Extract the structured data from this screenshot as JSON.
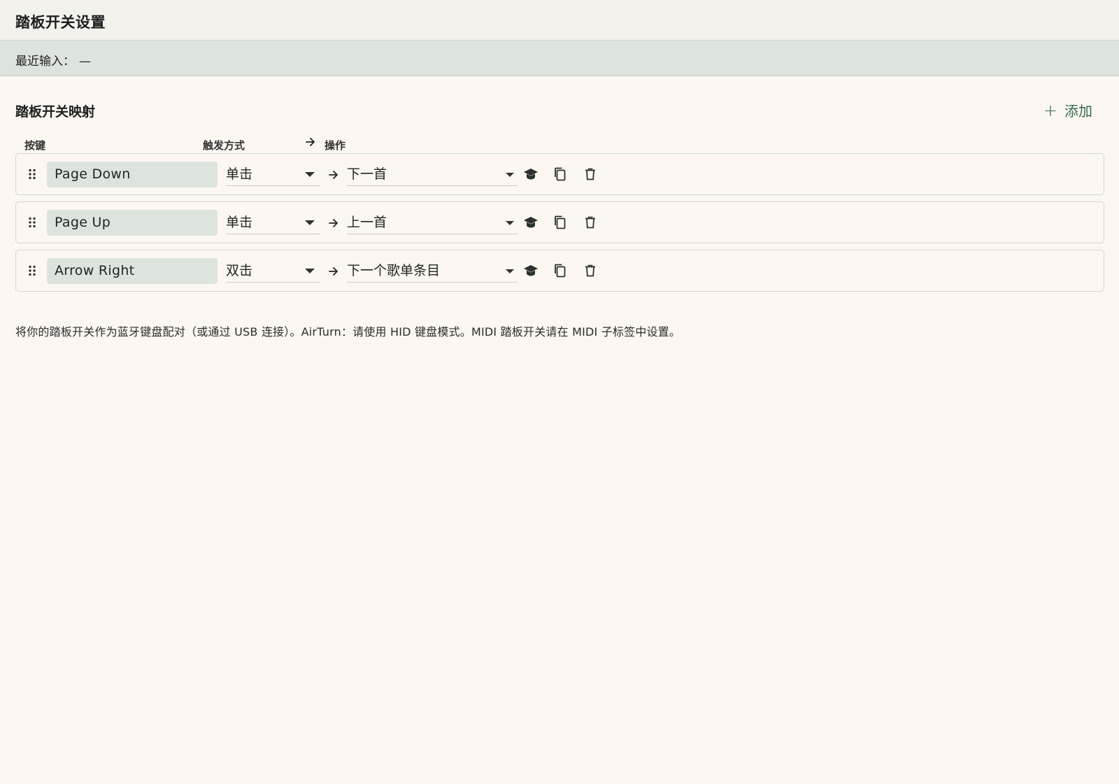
{
  "header": {
    "title": "踏板开关设置"
  },
  "status": {
    "label": "最近输入：",
    "value": "—"
  },
  "section": {
    "title": "踏板开关映射",
    "add_label": "添加",
    "add_icon": "plus-icon"
  },
  "columns": {
    "key": "按键",
    "trigger": "触发方式",
    "action": "操作"
  },
  "mappings": [
    {
      "key": "Page Down",
      "trigger": "单击",
      "action": "下一首"
    },
    {
      "key": "Page Up",
      "trigger": "单击",
      "action": "上一首"
    },
    {
      "key": "Arrow Right",
      "trigger": "双击",
      "action": "下一个歌单条目"
    }
  ],
  "icons": {
    "drag": "drag-handle-icon",
    "arrow": "arrow-right-icon",
    "learn": "learn-cap-icon",
    "copy": "copy-icon",
    "delete": "trash-icon"
  },
  "help": {
    "text": "将你的踏板开关作为蓝牙键盘配对（或通过 USB 连接）。AirTurn：请使用 HID 键盘模式。MIDI 踏板开关请在 MIDI 子标签中设置。"
  },
  "colors": {
    "background": "#fdf7f1",
    "header_bg": "#f3f2ed",
    "status_bg": "#dde4de",
    "accent": "#2f6b4c",
    "field_bg": "#dde4de",
    "border": "#cfd6d0"
  }
}
